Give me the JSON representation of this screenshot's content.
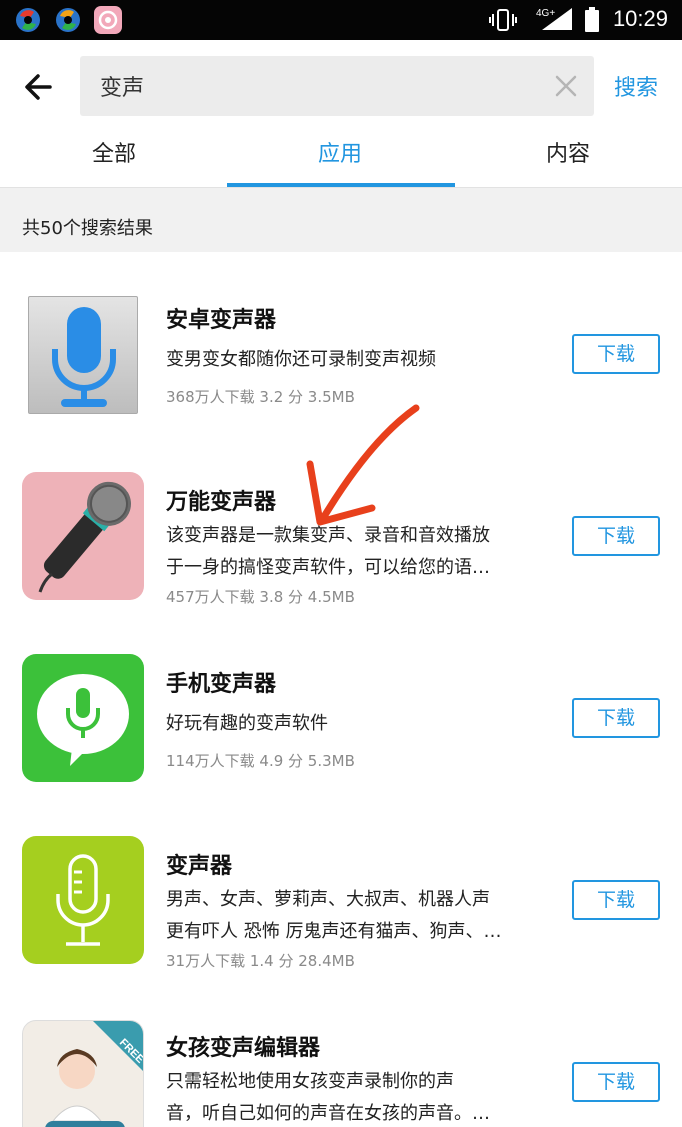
{
  "status_bar": {
    "time": "10:29",
    "network": "4G+"
  },
  "header": {
    "search_query": "变声",
    "search_button": "搜索",
    "tabs": [
      {
        "label": "全部"
      },
      {
        "label": "应用"
      },
      {
        "label": "内容"
      }
    ]
  },
  "results": {
    "count_text": "共50个搜索结果"
  },
  "apps": [
    {
      "name": "安卓变声器",
      "desc_line1": "变男变女都随你还可录制变声视频",
      "desc_line2": "",
      "meta": "368万人下载  3.2 分   3.5MB",
      "button": "下载"
    },
    {
      "name": "万能变声器",
      "desc_line1": "该变声器是一款集变声、录音和音效播放",
      "desc_line2": "于一身的搞怪变声软件，可以给您的语…",
      "meta": "457万人下载  3.8 分   4.5MB",
      "button": "下载"
    },
    {
      "name": "手机变声器",
      "desc_line1": "好玩有趣的变声软件",
      "desc_line2": "",
      "meta": "114万人下载  4.9 分   5.3MB",
      "button": "下载"
    },
    {
      "name": "变声器",
      "desc_line1": "男声、女声、萝莉声、大叔声、机器人声",
      "desc_line2": "更有吓人 恐怖 厉鬼声还有猫声、狗声、…",
      "meta": "31万人下载  1.4 分   28.4MB",
      "button": "下载"
    },
    {
      "name": "女孩变声编辑器",
      "desc_line1": "只需轻松地使用女孩变声录制你的声",
      "desc_line2": "音，听自己如何的声音在女孩的声音。…",
      "meta": "",
      "button": "下载",
      "badge": "FREE"
    }
  ],
  "colors": {
    "accent": "#2296e0",
    "annotation_arrow": "#e8401c"
  }
}
